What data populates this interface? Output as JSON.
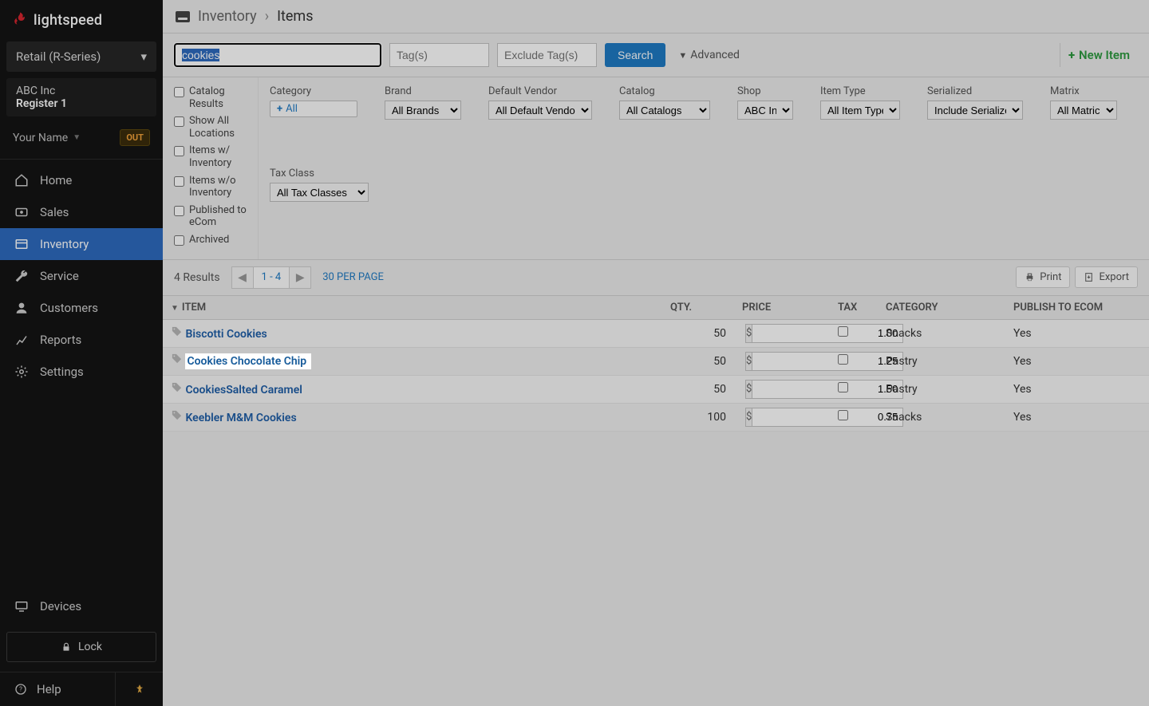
{
  "brand": "lightspeed",
  "mode": "Retail (R-Series)",
  "store": {
    "company": "ABC Inc",
    "register": "Register 1"
  },
  "user": {
    "name": "Your Name",
    "badge": "OUT"
  },
  "nav": {
    "home": "Home",
    "sales": "Sales",
    "inventory": "Inventory",
    "service": "Service",
    "customers": "Customers",
    "reports": "Reports",
    "settings": "Settings",
    "devices": "Devices"
  },
  "lock": "Lock",
  "help": "Help",
  "breadcrumb": {
    "section": "Inventory",
    "current": "Items"
  },
  "toolbar": {
    "search_value": "cookies",
    "tags_placeholder": "Tag(s)",
    "exclude_placeholder": "Exclude Tag(s)",
    "search_btn": "Search",
    "advanced": "Advanced",
    "new_item": "New Item"
  },
  "filter_checks": {
    "catalog": "Catalog Results",
    "allloc": "Show All Locations",
    "withinv": "Items w/ Inventory",
    "noinv": "Items w/o Inventory",
    "pub": "Published to eCom",
    "archived": "Archived"
  },
  "filters": {
    "category_label": "Category",
    "category_all": "All",
    "brand_label": "Brand",
    "brand_value": "All Brands",
    "vendor_label": "Default Vendor",
    "vendor_value": "All Default Vendors",
    "catalog_label": "Catalog",
    "catalog_value": "All Catalogs",
    "shop_label": "Shop",
    "shop_value": "ABC Inc",
    "type_label": "Item Type",
    "type_value": "All Item Types",
    "serial_label": "Serialized",
    "serial_value": "Include Serialized",
    "matrix_label": "Matrix",
    "matrix_value": "All Matrices",
    "taxclass_label": "Tax Class",
    "taxclass_value": "All Tax Classes"
  },
  "results": {
    "count": "4 Results",
    "range": "1 - 4",
    "perpage": "30 PER PAGE",
    "print": "Print",
    "export": "Export"
  },
  "table": {
    "headers": {
      "item": "ITEM",
      "qty": "QTY.",
      "price": "PRICE",
      "tax": "TAX",
      "category": "CATEGORY",
      "publish": "PUBLISH TO ECOM"
    },
    "rows": [
      {
        "name": "Biscotti Cookies",
        "qty": "50",
        "price": "1.00",
        "category": "Snacks",
        "publish": "Yes",
        "hl": false
      },
      {
        "name": "Cookies Chocolate Chip",
        "qty": "50",
        "price": "1.25",
        "category": "Pastry",
        "publish": "Yes",
        "hl": true
      },
      {
        "name": "CookiesSalted Caramel",
        "qty": "50",
        "price": "1.50",
        "category": "Pastry",
        "publish": "Yes",
        "hl": false
      },
      {
        "name": "Keebler M&M Cookies",
        "qty": "100",
        "price": "0.75",
        "category": "Snacks",
        "publish": "Yes",
        "hl": false
      }
    ],
    "currency": "$"
  }
}
